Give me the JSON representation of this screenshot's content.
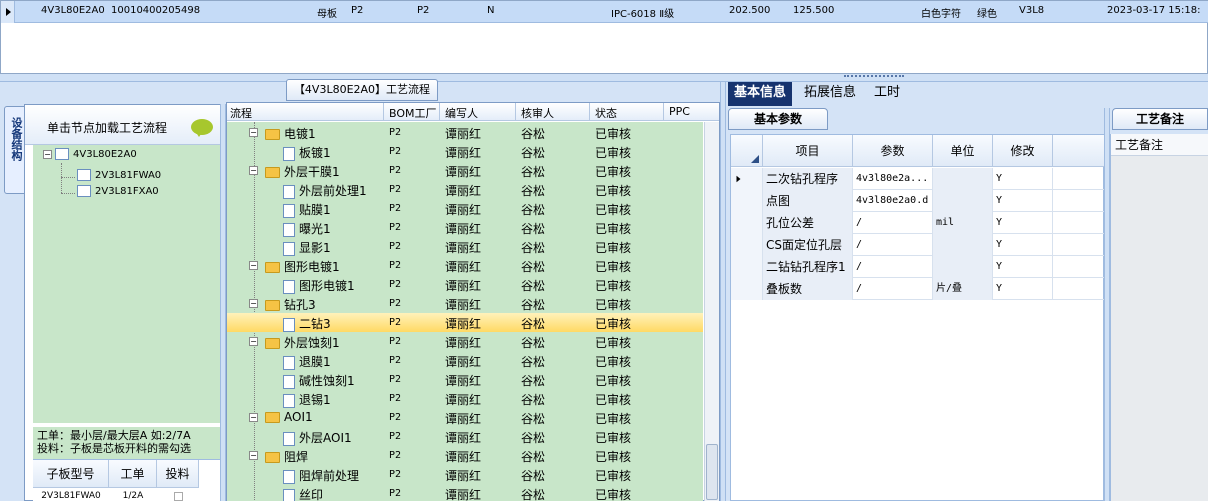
{
  "top_row": {
    "code": "4V3L80E2A0",
    "number": "10010400205498",
    "type": "母板",
    "factory1": "P2",
    "factory2": "P2",
    "flag": "N",
    "model": "IPC-6018 Ⅱ级",
    "dim1": "202.500",
    "dim2": "125.500",
    "char_color": "白色字符",
    "mask_color": "绿色",
    "version": "V3L8",
    "datetime": "2023-03-17 15:18:"
  },
  "left": {
    "vertical_tab": "设备结构",
    "header": "单击节点加载工艺流程",
    "tree": [
      "4V3L80E2A0",
      "2V3L81FWA0",
      "2V3L81FXA0"
    ],
    "note_line1": "工单：最小层/最大层A 如:2/7A",
    "note_line2": "投料：子板是芯板开料的需勾选",
    "grid_headers": [
      "子板型号",
      "工单",
      "投料"
    ],
    "grid_row": [
      "2V3L81FWA0",
      "1/2A",
      ""
    ]
  },
  "flow": {
    "title": "【4V3L80E2A0】工艺流程",
    "headers": [
      "流程",
      "BOM工厂",
      "编写人",
      "核审人",
      "状态",
      "PPC"
    ],
    "rows": [
      {
        "name": "电镀1",
        "bom": "P2",
        "writer": "谭丽红",
        "reviewer": "谷松",
        "status": "已审核",
        "kind": "folder"
      },
      {
        "name": "板镀1",
        "bom": "P2",
        "writer": "谭丽红",
        "reviewer": "谷松",
        "status": "已审核",
        "kind": "doc"
      },
      {
        "name": "外层干膜1",
        "bom": "P2",
        "writer": "谭丽红",
        "reviewer": "谷松",
        "status": "已审核",
        "kind": "folder"
      },
      {
        "name": "外层前处理1",
        "bom": "P2",
        "writer": "谭丽红",
        "reviewer": "谷松",
        "status": "已审核",
        "kind": "doc"
      },
      {
        "name": "贴膜1",
        "bom": "P2",
        "writer": "谭丽红",
        "reviewer": "谷松",
        "status": "已审核",
        "kind": "doc"
      },
      {
        "name": "曝光1",
        "bom": "P2",
        "writer": "谭丽红",
        "reviewer": "谷松",
        "status": "已审核",
        "kind": "doc"
      },
      {
        "name": "显影1",
        "bom": "P2",
        "writer": "谭丽红",
        "reviewer": "谷松",
        "status": "已审核",
        "kind": "doc"
      },
      {
        "name": "图形电镀1",
        "bom": "P2",
        "writer": "谭丽红",
        "reviewer": "谷松",
        "status": "已审核",
        "kind": "folder"
      },
      {
        "name": "图形电镀1",
        "bom": "P2",
        "writer": "谭丽红",
        "reviewer": "谷松",
        "status": "已审核",
        "kind": "doc"
      },
      {
        "name": "钻孔3",
        "bom": "P2",
        "writer": "谭丽红",
        "reviewer": "谷松",
        "status": "已审核",
        "kind": "folder"
      },
      {
        "name": "二钻3",
        "bom": "P2",
        "writer": "谭丽红",
        "reviewer": "谷松",
        "status": "已审核",
        "kind": "doc"
      },
      {
        "name": "外层蚀刻1",
        "bom": "P2",
        "writer": "谭丽红",
        "reviewer": "谷松",
        "status": "已审核",
        "kind": "folder"
      },
      {
        "name": "退膜1",
        "bom": "P2",
        "writer": "谭丽红",
        "reviewer": "谷松",
        "status": "已审核",
        "kind": "doc"
      },
      {
        "name": "碱性蚀刻1",
        "bom": "P2",
        "writer": "谭丽红",
        "reviewer": "谷松",
        "status": "已审核",
        "kind": "doc"
      },
      {
        "name": "退锡1",
        "bom": "P2",
        "writer": "谭丽红",
        "reviewer": "谷松",
        "status": "已审核",
        "kind": "doc"
      },
      {
        "name": "AOI1",
        "bom": "P2",
        "writer": "谭丽红",
        "reviewer": "谷松",
        "status": "已审核",
        "kind": "folder"
      },
      {
        "name": "外层AOI1",
        "bom": "P2",
        "writer": "谭丽红",
        "reviewer": "谷松",
        "status": "已审核",
        "kind": "doc"
      },
      {
        "name": "阻焊",
        "bom": "P2",
        "writer": "谭丽红",
        "reviewer": "谷松",
        "status": "已审核",
        "kind": "folder"
      },
      {
        "name": "阻焊前处理",
        "bom": "P2",
        "writer": "谭丽红",
        "reviewer": "谷松",
        "status": "已审核",
        "kind": "doc"
      },
      {
        "name": "丝印",
        "bom": "P2",
        "writer": "谭丽红",
        "reviewer": "谷松",
        "status": "已审核",
        "kind": "doc"
      }
    ]
  },
  "right": {
    "tabs": [
      "基本信息",
      "拓展信息",
      "工时"
    ],
    "subtab": "基本参数",
    "param_headers": [
      "项目",
      "参数",
      "单位",
      "修改"
    ],
    "params": [
      [
        "二次钻孔程序",
        "4v3l80e2a...",
        "",
        "Y"
      ],
      [
        "点图",
        "4v3l80e2a0.d",
        "",
        "Y"
      ],
      [
        "孔位公差",
        "/",
        "mil",
        "Y"
      ],
      [
        "CS面定位孔层",
        "/",
        "",
        "Y"
      ],
      [
        "二钻钻孔程序1",
        "/",
        "",
        "Y"
      ],
      [
        "叠板数",
        "/",
        "片/叠",
        "Y"
      ]
    ],
    "remark_header": "工艺备注",
    "remark_label": "工艺备注"
  },
  "colors": {
    "accent": "#16336e",
    "tree_bg": "#c8e6c9",
    "selected_row": "#ffd964",
    "header_row": "#c5dbf7"
  }
}
